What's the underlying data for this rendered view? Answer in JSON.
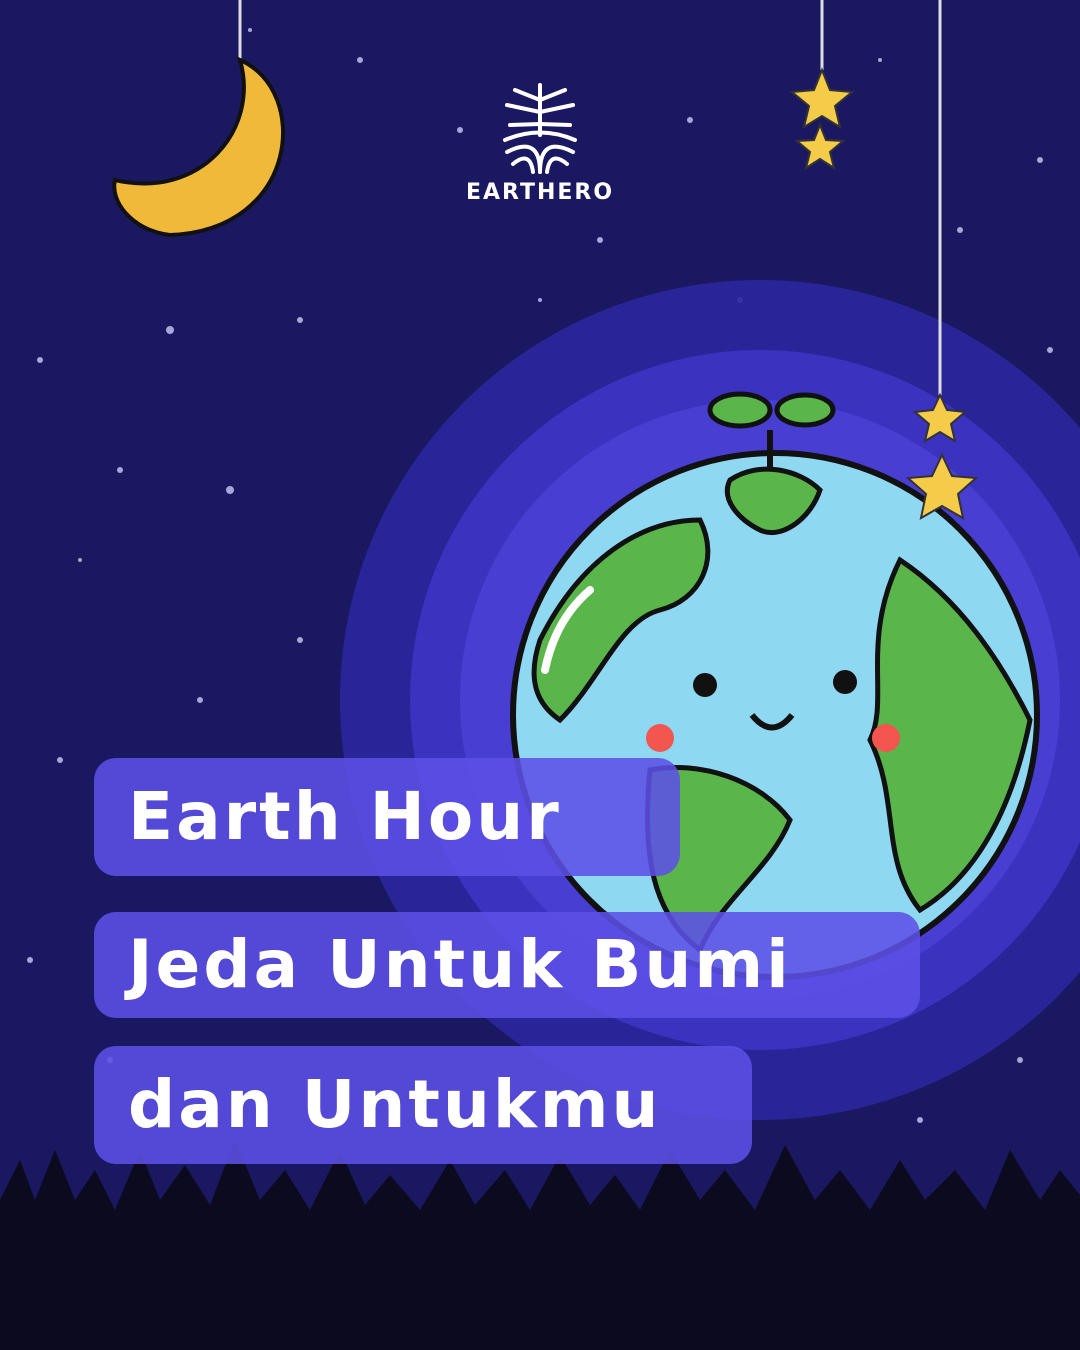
{
  "brand": {
    "name": "EARTHERO",
    "logo_icon": "tree-globe-logo"
  },
  "headline": {
    "line1": "Earth Hour",
    "line2": "Jeda Untuk Bumi",
    "line3": "dan Untukmu"
  },
  "colors": {
    "background": "#1b1862",
    "title_box": "#5c50e6",
    "halo": "#3b33c8",
    "globe_ocean": "#8ed8f2",
    "globe_land": "#5ab54a"
  }
}
